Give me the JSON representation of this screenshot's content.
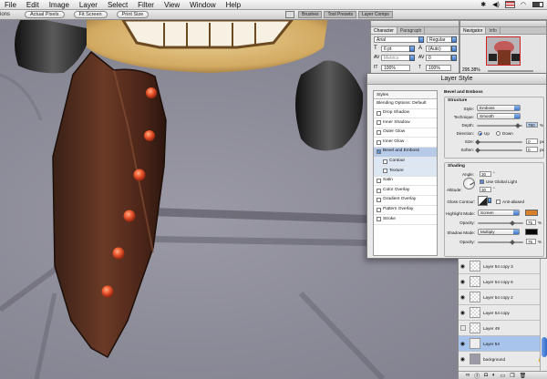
{
  "menubar": {
    "apple": "",
    "items": [
      "File",
      "Edit",
      "Image",
      "Layer",
      "Select",
      "Filter",
      "View",
      "Window",
      "Help"
    ],
    "status_icons": [
      "bluetooth-icon",
      "volume-icon",
      "flag-icon",
      "wifi-icon",
      "battery-icon"
    ]
  },
  "options_bar": {
    "tool_label": "ions",
    "buttons": [
      "Actual Pixels",
      "Fit Screen",
      "Print Size"
    ],
    "palette_well_tabs": [
      "Brushes",
      "Tool Presets",
      "Layer Comps"
    ]
  },
  "character_panel": {
    "tabs": [
      "Character",
      "Paragraph"
    ],
    "font_family": "Arial",
    "font_style": "Regular",
    "font_size": "6 pt",
    "leading": "(Auto)",
    "kerning": "Metrics",
    "tracking": "0",
    "vertical_scale": "100%",
    "horizontal_scale": "100%"
  },
  "navigator_panel": {
    "tabs": [
      "Navigator",
      "Info"
    ],
    "zoom": "295.38%"
  },
  "layer_style": {
    "title": "Layer Style",
    "styles_header": "Styles",
    "blending_options": "Blending Options: Default",
    "effects": [
      {
        "label": "Drop Shadow",
        "checked": false
      },
      {
        "label": "Inner Shadow",
        "checked": false
      },
      {
        "label": "Outer Glow",
        "checked": false
      },
      {
        "label": "Inner Glow",
        "checked": false
      },
      {
        "label": "Bevel and Emboss",
        "checked": true
      },
      {
        "label": "Contour",
        "checked": false
      },
      {
        "label": "Texture",
        "checked": false
      },
      {
        "label": "Satin",
        "checked": false
      },
      {
        "label": "Color Overlay",
        "checked": false
      },
      {
        "label": "Gradient Overlay",
        "checked": false
      },
      {
        "label": "Pattern Overlay",
        "checked": false
      },
      {
        "label": "Stroke",
        "checked": false
      }
    ],
    "bevel": {
      "section": "Bevel and Emboss",
      "structure": "Structure",
      "style_label": "Style:",
      "style_value": "Emboss",
      "technique_label": "Technique:",
      "technique_value": "Smooth",
      "depth_label": "Depth:",
      "depth_value": "780",
      "depth_unit": "%",
      "direction_label": "Direction:",
      "direction_up": "Up",
      "direction_down": "Down",
      "direction_selected": "Up",
      "size_label": "Size:",
      "size_value": "0",
      "size_unit": "px",
      "soften_label": "Soften:",
      "soften_value": "0",
      "soften_unit": "px",
      "shading": "Shading",
      "angle_label": "Angle:",
      "angle_value": "30",
      "angle_unit": "°",
      "global_light_label": "Use Global Light",
      "global_light_checked": true,
      "altitude_label": "Altitude:",
      "altitude_value": "30",
      "altitude_unit": "°",
      "gloss_label": "Gloss Contour:",
      "anti_aliased_label": "Anti-aliased",
      "highlight_mode_label": "Highlight Mode:",
      "highlight_mode_value": "Screen",
      "highlight_color": "#d9812a",
      "highlight_opacity_label": "Opacity:",
      "highlight_opacity_value": "75",
      "highlight_opacity_unit": "%",
      "shadow_mode_label": "Shadow Mode:",
      "shadow_mode_value": "Multiply",
      "shadow_color": "#0a0a0a",
      "shadow_opacity_label": "Opacity:",
      "shadow_opacity_value": "75",
      "shadow_opacity_unit": "%"
    }
  },
  "layers": [
    {
      "name": "Layer 54 copy 3",
      "visible": true,
      "selected": false
    },
    {
      "name": "Layer 54 copy 6",
      "visible": true,
      "selected": false
    },
    {
      "name": "Layer 54 copy 2",
      "visible": true,
      "selected": false
    },
    {
      "name": "Layer 54 copy",
      "visible": true,
      "selected": false
    },
    {
      "name": "Layer 49",
      "visible": false,
      "selected": false
    },
    {
      "name": "Layer 54",
      "visible": true,
      "selected": true
    },
    {
      "name": "background",
      "visible": true,
      "selected": false
    }
  ],
  "layers_toolbar_icons": [
    "link-icon",
    "fx-icon",
    "mask-icon",
    "adjustment-icon",
    "folder-icon",
    "new-layer-icon",
    "trash-icon"
  ],
  "colors": {
    "button_blue": "#3f78cf",
    "selection_blue": "#a9c4ec",
    "canvas_bg": "#8c8b98"
  }
}
